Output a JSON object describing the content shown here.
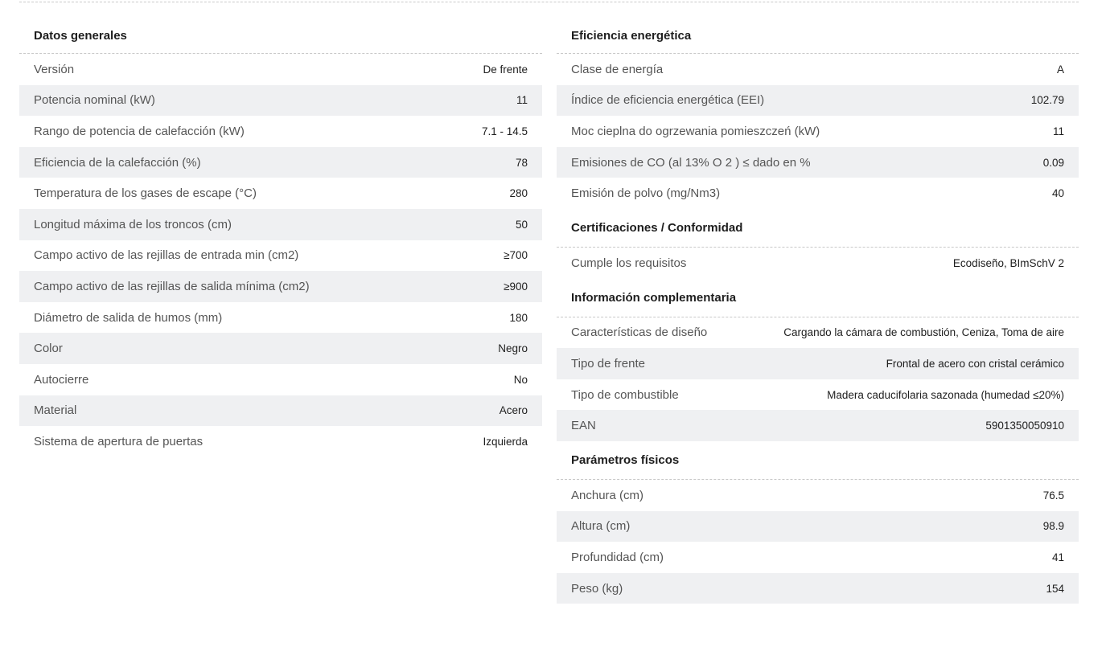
{
  "general": {
    "title": "Datos generales",
    "rows": [
      {
        "label": "Versión",
        "value": "De frente"
      },
      {
        "label": "Potencia nominal (kW)",
        "value": "11"
      },
      {
        "label": "Rango de potencia de calefacción (kW)",
        "value": "7.1 - 14.5"
      },
      {
        "label": "Eficiencia de la calefacción (%)",
        "value": "78"
      },
      {
        "label": "Temperatura de los gases de escape (°C)",
        "value": "280"
      },
      {
        "label": "Longitud máxima de los troncos (cm)",
        "value": "50"
      },
      {
        "label": "Campo activo de las rejillas de entrada min (cm2)",
        "value": "≥700"
      },
      {
        "label": "Campo activo de las rejillas de salida mínima (cm2)",
        "value": "≥900"
      },
      {
        "label": "Diámetro de salida de humos (mm)",
        "value": "180"
      },
      {
        "label": "Color",
        "value": "Negro"
      },
      {
        "label": "Autocierre",
        "value": "No"
      },
      {
        "label": "Material",
        "value": "Acero"
      },
      {
        "label": "Sistema de apertura de puertas",
        "value": "Izquierda"
      }
    ]
  },
  "energy": {
    "title": "Eficiencia energética",
    "rows": [
      {
        "label": "Clase de energía",
        "value": "A"
      },
      {
        "label": "Índice de eficiencia energética (EEI)",
        "value": "102.79"
      },
      {
        "label": "Moc cieplna do ogrzewania pomieszczeń (kW)",
        "value": "11"
      },
      {
        "label": "Emisiones de CO (al 13% O 2 ) ≤ dado en %",
        "value": "0.09"
      },
      {
        "label": "Emisión de polvo (mg/Nm3)",
        "value": "40"
      }
    ]
  },
  "certifications": {
    "title": "Certificaciones / Conformidad",
    "rows": [
      {
        "label": "Cumple los requisitos",
        "value": "Ecodiseño, BImSchV 2"
      }
    ]
  },
  "complementary": {
    "title": "Información complementaria",
    "rows": [
      {
        "label": "Características de diseño",
        "value": "Cargando la cámara de combustión, Ceniza, Toma de aire"
      },
      {
        "label": "Tipo de frente",
        "value": "Frontal de acero con cristal cerámico"
      },
      {
        "label": "Tipo de combustible",
        "value": "Madera caducifolaria sazonada (humedad ≤20%)"
      },
      {
        "label": "EAN",
        "value": "5901350050910"
      }
    ]
  },
  "physical": {
    "title": "Parámetros físicos",
    "rows": [
      {
        "label": "Anchura (cm)",
        "value": "76.5"
      },
      {
        "label": "Altura (cm)",
        "value": "98.9"
      },
      {
        "label": "Profundidad (cm)",
        "value": "41"
      },
      {
        "label": "Peso (kg)",
        "value": "154"
      }
    ]
  }
}
